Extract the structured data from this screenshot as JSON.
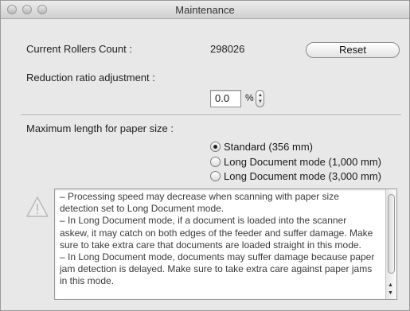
{
  "window": {
    "title": "Maintenance"
  },
  "rollers": {
    "label": "Current Rollers Count :",
    "value": "298026",
    "reset_label": "Reset"
  },
  "reduction": {
    "label": "Reduction ratio adjustment :",
    "value": "0.0",
    "unit": "%"
  },
  "paper": {
    "label": "Maximum length for paper size :",
    "options": [
      {
        "label": "Standard (356 mm)",
        "selected": true
      },
      {
        "label": "Long Document mode (1,000 mm)",
        "selected": false
      },
      {
        "label": "Long Document mode (3,000 mm)",
        "selected": false
      }
    ]
  },
  "notice": {
    "icon": "warning-icon",
    "text": "– Processing speed may decrease when scanning with paper size detection set to Long Document mode.\n– In Long Document mode, if a document is loaded into the scanner askew, it may catch on both edges of the feeder and suffer damage. Make sure to take extra care that documents are loaded straight in this mode.\n– In Long Document mode, documents may suffer damage because paper jam detection is delayed. Make sure to take extra care against paper jams in this mode."
  }
}
